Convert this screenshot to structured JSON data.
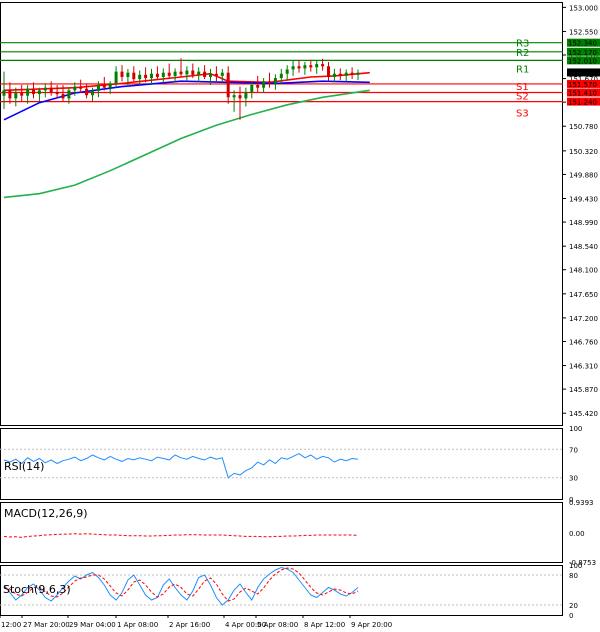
{
  "chart_data": {
    "type": "candlestick",
    "price_axis": {
      "ylim": [
        145.2,
        153.1
      ],
      "ticks": [
        "153.000",
        "152.550",
        "152.110",
        "151.670",
        "151.230",
        "150.780",
        "150.320",
        "149.880",
        "149.430",
        "148.990",
        "148.540",
        "148.100",
        "147.650",
        "147.200",
        "146.760",
        "146.310",
        "145.870",
        "145.420"
      ]
    },
    "current_price": "151.784",
    "time_labels": [
      "12:00",
      "27 Mar 20:00",
      "29 Mar 04:00",
      "1 Apr 08:00",
      "2 Apr 16:00",
      "4 Apr 00:00",
      "5 Apr 08:00",
      "8 Apr 12:00",
      "9 Apr 20:00"
    ],
    "candles": [
      [
        151.35,
        151.8,
        151.1,
        151.45
      ],
      [
        151.45,
        151.6,
        151.2,
        151.3
      ],
      [
        151.3,
        151.5,
        151.15,
        151.4
      ],
      [
        151.4,
        151.55,
        151.25,
        151.35
      ],
      [
        151.35,
        151.55,
        151.2,
        151.48
      ],
      [
        151.48,
        151.6,
        151.3,
        151.38
      ],
      [
        151.38,
        151.5,
        151.25,
        151.45
      ],
      [
        151.45,
        151.58,
        151.32,
        151.5
      ],
      [
        151.5,
        151.62,
        151.35,
        151.42
      ],
      [
        151.42,
        151.55,
        151.3,
        151.38
      ],
      [
        151.38,
        151.55,
        151.25,
        151.3
      ],
      [
        151.3,
        151.5,
        151.2,
        151.45
      ],
      [
        151.45,
        151.6,
        151.35,
        151.52
      ],
      [
        151.52,
        151.65,
        151.4,
        151.48
      ],
      [
        151.48,
        151.58,
        151.3,
        151.36
      ],
      [
        151.36,
        151.5,
        151.25,
        151.44
      ],
      [
        151.44,
        151.62,
        151.32,
        151.55
      ],
      [
        151.55,
        151.7,
        151.45,
        151.5
      ],
      [
        151.5,
        151.62,
        151.38,
        151.58
      ],
      [
        151.58,
        151.9,
        151.5,
        151.8
      ],
      [
        151.8,
        151.92,
        151.62,
        151.7
      ],
      [
        151.7,
        151.85,
        151.55,
        151.78
      ],
      [
        151.78,
        151.9,
        151.62,
        151.66
      ],
      [
        151.66,
        151.82,
        151.55,
        151.74
      ],
      [
        151.74,
        151.88,
        151.6,
        151.68
      ],
      [
        151.68,
        151.85,
        151.55,
        151.76
      ],
      [
        151.76,
        151.9,
        151.65,
        151.7
      ],
      [
        151.7,
        151.86,
        151.58,
        151.78
      ],
      [
        151.78,
        151.95,
        151.66,
        151.72
      ],
      [
        151.72,
        151.86,
        151.6,
        151.8
      ],
      [
        151.8,
        152.05,
        151.7,
        151.75
      ],
      [
        151.75,
        151.9,
        151.62,
        151.82
      ],
      [
        151.82,
        151.95,
        151.68,
        151.74
      ],
      [
        151.74,
        151.88,
        151.6,
        151.8
      ],
      [
        151.8,
        151.92,
        151.66,
        151.7
      ],
      [
        151.7,
        151.85,
        151.55,
        151.76
      ],
      [
        151.76,
        151.9,
        151.62,
        151.72
      ],
      [
        151.72,
        151.85,
        151.6,
        151.78
      ],
      [
        151.78,
        151.9,
        151.2,
        151.32
      ],
      [
        151.32,
        151.45,
        151.05,
        151.36
      ],
      [
        151.36,
        151.52,
        150.9,
        151.3
      ],
      [
        151.3,
        151.5,
        151.15,
        151.42
      ],
      [
        151.42,
        151.6,
        151.3,
        151.55
      ],
      [
        151.55,
        151.72,
        151.42,
        151.5
      ],
      [
        151.5,
        151.68,
        151.4,
        151.62
      ],
      [
        151.62,
        151.78,
        151.5,
        151.58
      ],
      [
        151.58,
        151.75,
        151.46,
        151.68
      ],
      [
        151.68,
        151.85,
        151.56,
        151.76
      ],
      [
        151.76,
        151.92,
        151.64,
        151.84
      ],
      [
        151.84,
        152.0,
        151.72,
        151.9
      ],
      [
        151.9,
        152.02,
        151.78,
        151.86
      ],
      [
        151.86,
        151.98,
        151.74,
        151.92
      ],
      [
        151.92,
        152.02,
        151.8,
        151.88
      ],
      [
        151.88,
        152.0,
        151.76,
        151.94
      ],
      [
        151.94,
        152.04,
        151.82,
        151.9
      ],
      [
        151.9,
        151.98,
        151.62,
        151.7
      ],
      [
        151.7,
        151.85,
        151.6,
        151.76
      ],
      [
        151.76,
        151.86,
        151.64,
        151.72
      ],
      [
        151.72,
        151.84,
        151.62,
        151.78
      ],
      [
        151.78,
        151.88,
        151.66,
        151.74
      ],
      [
        151.74,
        151.84,
        151.64,
        151.78
      ]
    ],
    "moving_averages": [
      {
        "color": "#ff0000",
        "points": [
          [
            0,
            151.45
          ],
          [
            12,
            151.5
          ],
          [
            20,
            151.58
          ],
          [
            30,
            151.7
          ],
          [
            35,
            151.76
          ],
          [
            38,
            151.62
          ],
          [
            45,
            151.6
          ],
          [
            52,
            151.7
          ],
          [
            56,
            151.72
          ],
          [
            62,
            151.78
          ]
        ]
      },
      {
        "color": "#0000ff",
        "points": [
          [
            0,
            150.9
          ],
          [
            6,
            151.22
          ],
          [
            12,
            151.4
          ],
          [
            20,
            151.52
          ],
          [
            30,
            151.62
          ],
          [
            38,
            151.6
          ],
          [
            46,
            151.58
          ],
          [
            54,
            151.62
          ],
          [
            62,
            151.6
          ]
        ]
      },
      {
        "color": "#22b14c",
        "points": [
          [
            0,
            149.45
          ],
          [
            6,
            149.52
          ],
          [
            12,
            149.68
          ],
          [
            18,
            149.95
          ],
          [
            24,
            150.25
          ],
          [
            30,
            150.55
          ],
          [
            36,
            150.8
          ],
          [
            42,
            151.0
          ],
          [
            48,
            151.18
          ],
          [
            54,
            151.32
          ],
          [
            62,
            151.45
          ]
        ]
      }
    ],
    "levels": [
      {
        "name": "R3",
        "value": "152.340",
        "type": "resistance",
        "color": "#008000",
        "lvl": 152.34
      },
      {
        "name": "R2",
        "value": "152.170",
        "type": "resistance",
        "color": "#008000",
        "lvl": 152.17
      },
      {
        "name": "R1",
        "value": "152.010",
        "type": "resistance",
        "color": "#008000",
        "lvl": 152.01
      },
      {
        "name": "S1",
        "value": "151.570",
        "type": "support",
        "color": "#ff0000",
        "lvl": 151.57
      },
      {
        "name": "S2",
        "value": "151.410",
        "type": "support",
        "color": "#ff0000",
        "lvl": 151.41
      },
      {
        "name": "S3",
        "value": "151.240",
        "type": "support",
        "color": "#ff0000",
        "lvl": 151.24
      }
    ],
    "indicators": {
      "rsi": {
        "label": "RSI(14)",
        "ticks": [
          "100",
          "70",
          "30",
          "0"
        ],
        "ylim": [
          0,
          100
        ],
        "values": [
          55,
          52,
          56,
          50,
          58,
          53,
          57,
          51,
          55,
          50,
          54,
          56,
          59,
          54,
          57,
          62,
          58,
          55,
          60,
          56,
          53,
          57,
          55,
          58,
          56,
          54,
          59,
          57,
          55,
          62,
          58,
          56,
          60,
          57,
          55,
          59,
          56,
          58,
          30,
          36,
          34,
          40,
          44,
          52,
          48,
          55,
          50,
          58,
          56,
          60,
          64,
          58,
          62,
          56,
          60,
          58,
          52,
          56,
          54,
          57,
          56
        ]
      },
      "macd": {
        "label": "MACD(12,26,9)",
        "ticks": [
          "0.9393",
          "0.00",
          "-0.8753"
        ],
        "ylim": [
          -0.8753,
          0.9393
        ],
        "values": [
          -0.1,
          -0.12,
          -0.11,
          -0.13,
          -0.1,
          -0.09,
          -0.08,
          -0.06,
          -0.05,
          -0.04,
          -0.03,
          -0.03,
          -0.02,
          -0.03,
          -0.02,
          -0.03,
          -0.04,
          -0.05,
          -0.06,
          -0.06,
          -0.07,
          -0.08,
          -0.08,
          -0.08,
          -0.09,
          -0.09,
          -0.08,
          -0.08,
          -0.07,
          -0.06,
          -0.06,
          -0.05,
          -0.05,
          -0.05,
          -0.06,
          -0.06,
          -0.06,
          -0.06,
          -0.07,
          -0.08,
          -0.09,
          -0.1,
          -0.1,
          -0.1,
          -0.11,
          -0.11,
          -0.1,
          -0.1,
          -0.09,
          -0.09,
          -0.08,
          -0.07,
          -0.07,
          -0.06,
          -0.06,
          -0.06,
          -0.06,
          -0.06,
          -0.06,
          -0.06,
          -0.07
        ]
      },
      "stoch": {
        "label": "Stoch(9,6,3)",
        "ticks": [
          "100",
          "80",
          "20",
          "0"
        ],
        "ylim": [
          0,
          100
        ],
        "main": [
          60,
          45,
          30,
          40,
          55,
          62,
          50,
          35,
          28,
          40,
          55,
          68,
          78,
          72,
          80,
          85,
          75,
          60,
          40,
          30,
          45,
          70,
          80,
          60,
          40,
          30,
          35,
          60,
          72,
          55,
          40,
          30,
          48,
          75,
          80,
          60,
          35,
          20,
          30,
          50,
          62,
          45,
          30,
          55,
          72,
          82,
          90,
          95,
          92,
          85,
          70,
          55,
          40,
          35,
          45,
          55,
          50,
          42,
          38,
          45,
          55
        ],
        "signal": [
          55,
          52,
          42,
          38,
          45,
          55,
          56,
          46,
          38,
          36,
          44,
          56,
          68,
          74,
          76,
          80,
          80,
          72,
          58,
          44,
          38,
          50,
          66,
          70,
          60,
          46,
          36,
          42,
          56,
          62,
          55,
          42,
          38,
          52,
          68,
          74,
          62,
          42,
          28,
          32,
          46,
          54,
          48,
          42,
          54,
          70,
          82,
          90,
          94,
          92,
          84,
          70,
          55,
          44,
          40,
          46,
          52,
          50,
          44,
          42,
          48
        ]
      }
    }
  }
}
